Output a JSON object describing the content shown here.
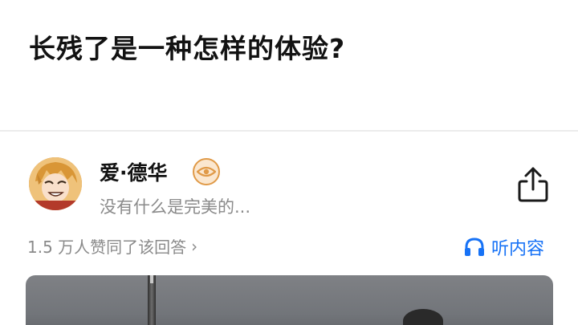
{
  "question": {
    "title": "长残了是一种怎样的体验?"
  },
  "author": {
    "name": "爱·德华",
    "bio": "没有什么是完美的...",
    "badge_icon": "eye-badge-icon",
    "avatar_icon": "anime-avatar"
  },
  "share": {
    "icon": "share-icon"
  },
  "stats": {
    "votes_text": "1.5 万人赞同了该回答",
    "chevron": "›"
  },
  "listen": {
    "label": "听内容",
    "icon": "headphones-icon",
    "color": "#1772f6"
  },
  "colors": {
    "accent": "#1772f6",
    "badge": "#e09a48",
    "secondary_text": "#8a8a8a"
  }
}
